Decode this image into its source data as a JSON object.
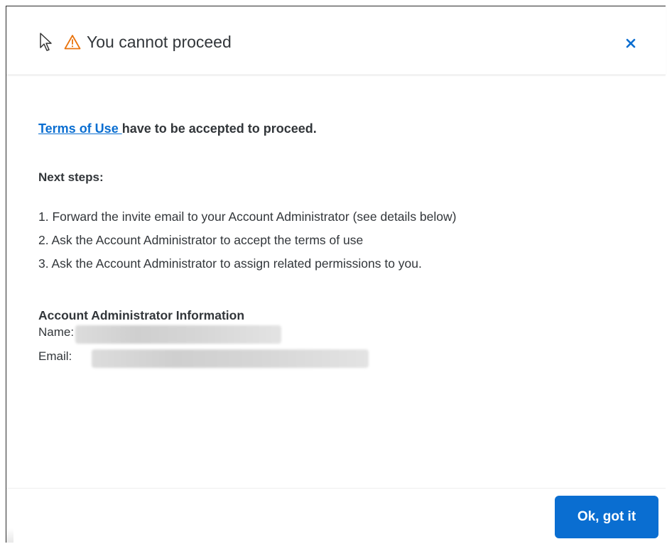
{
  "dialog": {
    "title": "You cannot proceed",
    "lead_link": "Terms of Use ",
    "lead_text": "have to be accepted to proceed.",
    "next_steps_heading": "Next steps:",
    "steps": [
      {
        "num": "1.",
        "text": " Forward the invite email to your Account Administrator (see details below)"
      },
      {
        "num": "2.",
        "text": " Ask the Account Administrator to accept the terms of use"
      },
      {
        "num": "3.",
        "text": " Ask the Account Administrator to assign related permissions to you."
      }
    ],
    "admin_heading": "Account Administrator Information",
    "name_label": "Name:",
    "email_label": "Email:",
    "ok_label": "Ok, got it"
  },
  "icons": {
    "cursor": "mouse-pointer-icon",
    "warning": "warning-triangle-icon",
    "close": "close-icon"
  },
  "colors": {
    "accent": "#0a6ed1",
    "warning": "#e9730c",
    "text": "#32363a"
  }
}
